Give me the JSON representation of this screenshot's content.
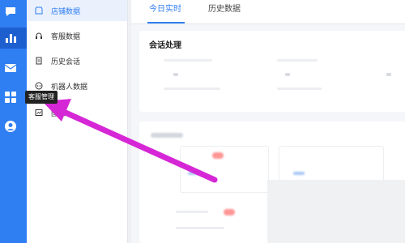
{
  "rail": {
    "icons": [
      "chat-bubble-icon",
      "bar-chart-icon",
      "mail-icon",
      "grid-apps-icon",
      "user-support-icon"
    ]
  },
  "tooltip": {
    "text": "客服管理"
  },
  "sidebar": {
    "items": [
      {
        "label": "店铺数据",
        "icon": "shop-icon",
        "active": true
      },
      {
        "label": "客服数据",
        "icon": "headset-icon",
        "active": false
      },
      {
        "label": "历史会话",
        "icon": "document-icon",
        "active": false
      },
      {
        "label": "机器人数据",
        "icon": "robot-icon",
        "active": false
      },
      {
        "label": "图表",
        "icon": "chart-box-icon",
        "active": false
      }
    ]
  },
  "tabs": [
    {
      "label": "今日实时",
      "active": true
    },
    {
      "label": "历史数据",
      "active": false
    }
  ],
  "card": {
    "title": "会话处理"
  },
  "colors": {
    "accent": "#2f7ef2",
    "rail": "#2f7ef2",
    "annotation_arrow": "#d627d6"
  }
}
